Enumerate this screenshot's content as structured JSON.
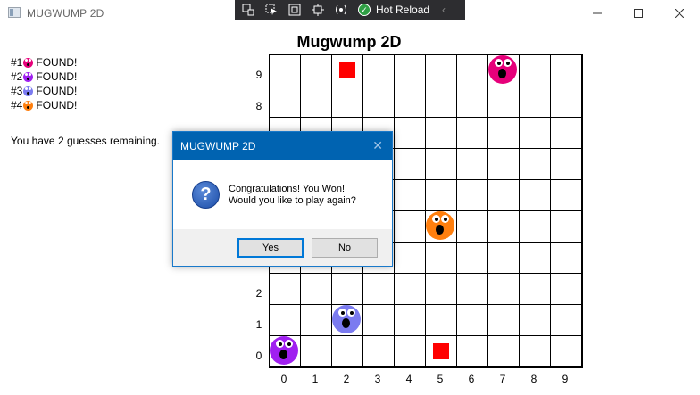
{
  "window": {
    "title": "MUGWUMP 2D"
  },
  "hot_reload": {
    "label": "Hot Reload"
  },
  "found": [
    {
      "prefix": "#1",
      "text": "FOUND!",
      "color": "#e6007a"
    },
    {
      "prefix": "#2",
      "text": "FOUND!",
      "color": "#a020f0"
    },
    {
      "prefix": "#3",
      "text": "FOUND!",
      "color": "#7b7bf0"
    },
    {
      "prefix": "#4",
      "text": "FOUND!",
      "color": "#ff7f0e"
    }
  ],
  "guesses_text": "You have 2 guesses remaining.",
  "board": {
    "title": "Mugwump 2D",
    "x_labels": [
      "0",
      "1",
      "2",
      "3",
      "4",
      "5",
      "6",
      "7",
      "8",
      "9"
    ],
    "y_labels": [
      "9",
      "8",
      "2",
      "1",
      "0"
    ],
    "guesses": [
      {
        "x": 2,
        "y": 9
      },
      {
        "x": 5,
        "y": 0
      }
    ],
    "mugwumps": [
      {
        "x": 7,
        "y": 9,
        "color": "#e6007a"
      },
      {
        "x": 5,
        "y": 4,
        "color": "#ff7f0e"
      },
      {
        "x": 2,
        "y": 1,
        "color": "#7b7bf0"
      },
      {
        "x": 0,
        "y": 0,
        "color": "#a020f0"
      }
    ]
  },
  "dialog": {
    "title": "MUGWUMP 2D",
    "line1": "Congratulations! You Won!",
    "line2": "Would you like to play again?",
    "yes": "Yes",
    "no": "No"
  }
}
